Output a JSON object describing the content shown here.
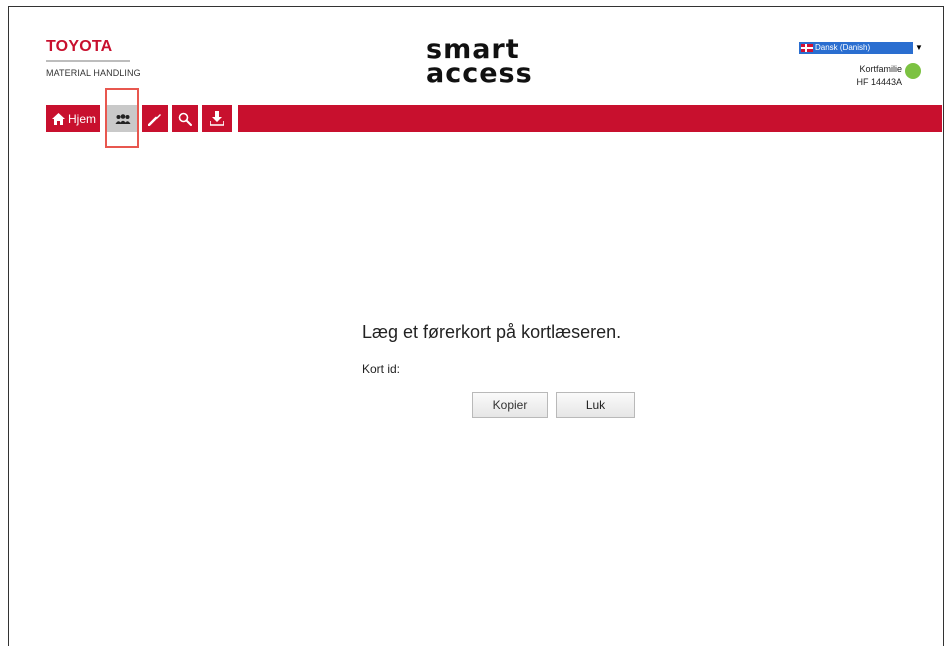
{
  "brand": {
    "name": "TOYOTA",
    "subtitle": "MATERIAL HANDLING"
  },
  "logo": {
    "line1": "smart",
    "line2": "access"
  },
  "language": {
    "selected": "Dansk (Danish)"
  },
  "status": {
    "label": "Kortfamilie",
    "code": "HF 14443A",
    "indicator_color": "#7cc242"
  },
  "toolbar": {
    "home_label": "Hjem",
    "items": [
      "home-icon",
      "users-icon",
      "wrench-icon",
      "search-icon",
      "download-icon"
    ],
    "accent_color": "#c8102e"
  },
  "dialog": {
    "message": "Læg et førerkort på kortlæseren.",
    "card_id_label": "Kort id:",
    "copy_button": "Kopier",
    "close_button": "Luk"
  }
}
